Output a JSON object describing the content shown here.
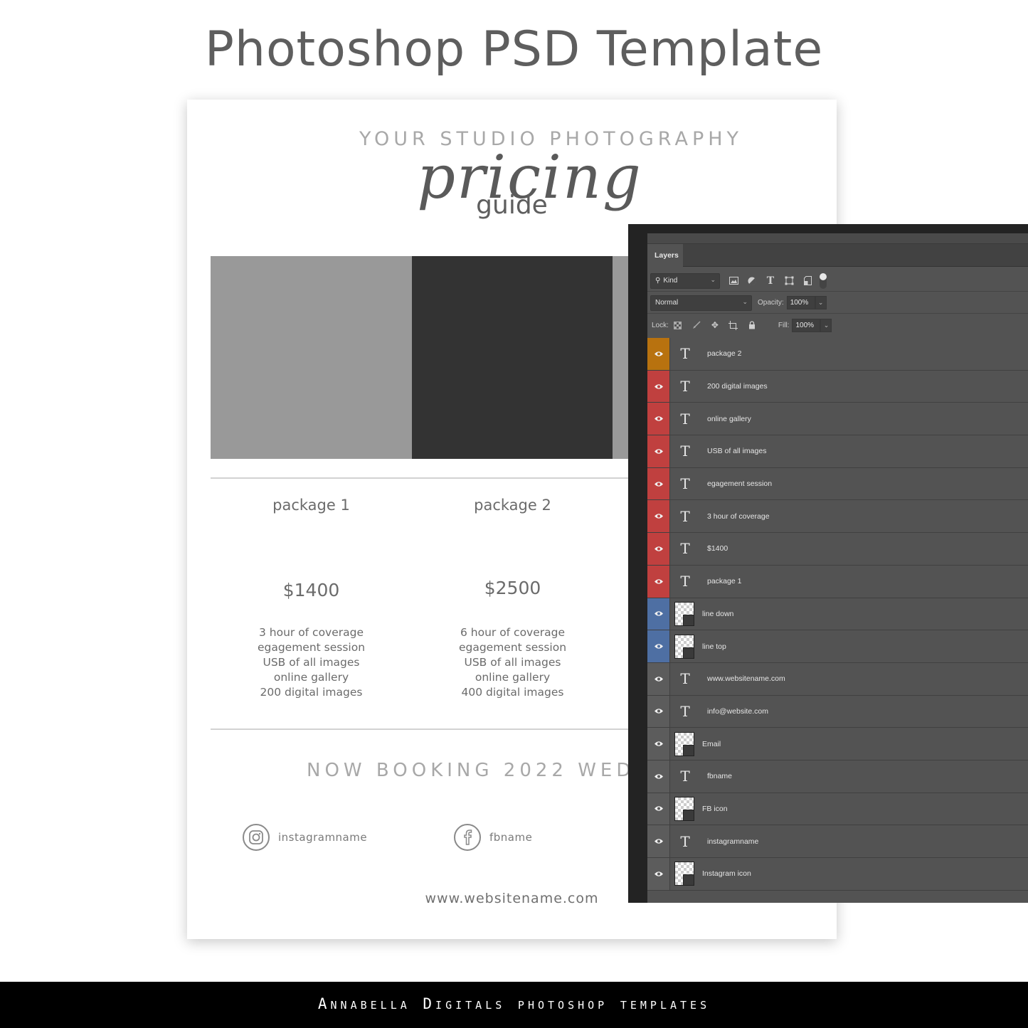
{
  "hero": {
    "title": "Photoshop PSD Template"
  },
  "flyer": {
    "studio_heading": "YOUR STUDIO PHOTOGRAPHY",
    "script_title": "pricing",
    "subtitle": "guide",
    "packages": [
      {
        "name": "package 1",
        "price": "$1400",
        "features": [
          "3 hour of coverage",
          "egagement session",
          "USB of all images",
          "online gallery",
          "200 digital images"
        ]
      },
      {
        "name": "package 2",
        "price": "$2500",
        "features": [
          "6 hour of coverage",
          "egagement session",
          "USB of all images",
          "online gallery",
          "400 digital images"
        ]
      }
    ],
    "booking_text": "NOW BOOKING 2022 WED",
    "instagram": {
      "icon": "instagram-icon",
      "handle": "instagramname"
    },
    "facebook": {
      "icon": "facebook-icon",
      "handle": "fbname"
    },
    "website": "www.websitename.com"
  },
  "photoshop": {
    "panel_tab": "Layers",
    "filter": {
      "label": "Kind",
      "icons": [
        "image-filter-icon",
        "adjustment-filter-icon",
        "type-filter-icon",
        "shape-filter-icon",
        "smart-object-filter-icon"
      ]
    },
    "blend_mode": "Normal",
    "opacity_label": "Opacity:",
    "opacity_value": "100%",
    "lock_label": "Lock:",
    "fill_label": "Fill:",
    "fill_value": "100%",
    "layers": [
      {
        "name": "package 2",
        "kind": "text",
        "color": "#b8720f"
      },
      {
        "name": "200 digital images",
        "kind": "text",
        "color": "#c0403f"
      },
      {
        "name": "online gallery",
        "kind": "text",
        "color": "#c0403f"
      },
      {
        "name": "USB of all images",
        "kind": "text",
        "color": "#c0403f"
      },
      {
        "name": "egagement session",
        "kind": "text",
        "color": "#c0403f"
      },
      {
        "name": "3 hour of coverage",
        "kind": "text",
        "color": "#c0403f"
      },
      {
        "name": "$1400",
        "kind": "text",
        "color": "#c0403f"
      },
      {
        "name": "package 1",
        "kind": "text",
        "color": "#c0403f"
      },
      {
        "name": "line down",
        "kind": "shape",
        "color": "#4e6fa3"
      },
      {
        "name": "line top",
        "kind": "shape",
        "color": "#4e6fa3"
      },
      {
        "name": "www.websitename.com",
        "kind": "text",
        "color": ""
      },
      {
        "name": "info@website.com",
        "kind": "text",
        "color": ""
      },
      {
        "name": "Email",
        "kind": "shape",
        "color": ""
      },
      {
        "name": "fbname",
        "kind": "text",
        "color": ""
      },
      {
        "name": "FB icon",
        "kind": "shape",
        "color": ""
      },
      {
        "name": "instagramname",
        "kind": "text",
        "color": ""
      },
      {
        "name": "Instagram icon",
        "kind": "shape",
        "color": ""
      }
    ]
  },
  "footer": {
    "brand": "Annabella Digitals photoshop templates"
  }
}
